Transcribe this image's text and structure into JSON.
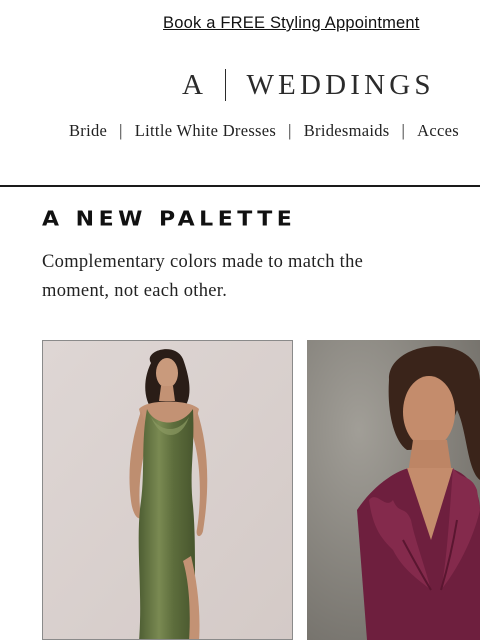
{
  "promo": {
    "label": "Book a FREE Styling Appointment"
  },
  "brand": {
    "mark": "A",
    "name": "WEDDINGS"
  },
  "nav": {
    "items": [
      {
        "label": "Bride"
      },
      {
        "label": "Little White Dresses"
      },
      {
        "label": "Bridesmaids"
      },
      {
        "label": "Acces"
      }
    ],
    "separator": "|"
  },
  "section": {
    "title": "A NEW PALETTE",
    "subtitle": "Complementary colors made to match the moment, not each other."
  },
  "products": [
    {
      "name": "green-satin-dress",
      "color": "#5f7040"
    },
    {
      "name": "plum-ruffle-dress",
      "color": "#6e1f3e"
    }
  ]
}
